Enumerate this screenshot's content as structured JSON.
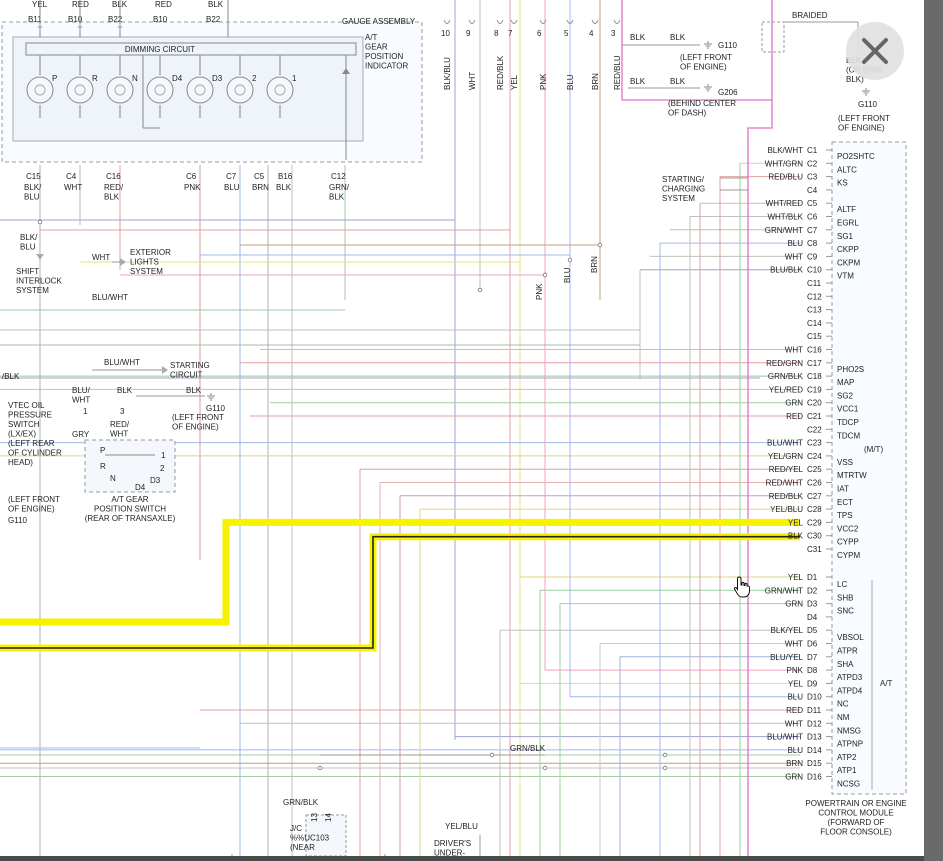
{
  "gauge": {
    "title": "GAUGE ASSEMBLY",
    "dimming": "DIMMING CIRCUIT",
    "indicator": [
      "A/T",
      "GEAR",
      "POSITION",
      "INDICATOR"
    ],
    "bulbs": [
      "P",
      "R",
      "N",
      "D4",
      "D3",
      "2",
      "1"
    ],
    "top_pins": [
      {
        "w": "YEL",
        "p": "B11"
      },
      {
        "w": "RED",
        "p": "B10"
      },
      {
        "w": "BLK",
        "p": "B22"
      }
    ],
    "bottom_pins": [
      {
        "p": "C15",
        "w": [
          "BLK/",
          "BLU"
        ]
      },
      {
        "p": "C4",
        "w": [
          "WHT"
        ]
      },
      {
        "p": "C16",
        "w": [
          "RED/",
          "BLK"
        ]
      },
      {
        "p": "C6",
        "w": [
          "PNK"
        ]
      },
      {
        "p": "C7",
        "w": [
          "BLU"
        ]
      },
      {
        "p": "C5",
        "w": [
          "BRN"
        ]
      },
      {
        "p": "B16",
        "w": [
          "BLK"
        ]
      },
      {
        "p": "C12",
        "w": [
          "GRN/",
          "BLK"
        ]
      }
    ]
  },
  "top_connector": {
    "pins": [
      "10",
      "9",
      "8",
      "7",
      "6",
      "5",
      "4",
      "3"
    ],
    "wires": [
      "BLK/BLU",
      "WHT",
      "RED/BLK",
      "YEL",
      "PNK",
      "BLU",
      "BRN",
      "RED/BLU"
    ]
  },
  "grounds": {
    "g110_top": {
      "wire1": "BLK",
      "wire2": "BLK",
      "id": "G110",
      "loc": [
        "(LEFT FRONT",
        "OF ENGINE)"
      ]
    },
    "g206": {
      "wire1": "BLK",
      "wire2": "BLK",
      "id": "G206",
      "loc": [
        "(BEHIND CENTER",
        "OF DASH)"
      ]
    },
    "braided": {
      "label": "BRAIDED",
      "wire": [
        "BLK",
        "(OR BRN/",
        "BLK)"
      ],
      "id": "G110",
      "loc": [
        "(LEFT FRONT",
        "OF ENGINE)"
      ]
    },
    "g110_mid": {
      "wire": "BLK",
      "id": "G110",
      "loc": [
        "(LEFT FRONT",
        "OF ENGINE)"
      ]
    },
    "g110_left": {
      "loc": [
        "(LEFT FRONT",
        "OF ENGINE)"
      ],
      "id": "G110"
    }
  },
  "left_labels": {
    "blk_blu": [
      "BLK/",
      "BLU"
    ],
    "shift": [
      "SHIFT",
      "INTERLOCK",
      "SYSTEM"
    ],
    "wht": "WHT",
    "exterior": [
      "EXTERIOR",
      "LIGHTS",
      "SYSTEM"
    ],
    "blu_wht": "BLU/WHT",
    "blu_wht2": "BLU/WHT",
    "starting": [
      "STARTING",
      "CIRCUIT"
    ],
    "blk_frag": "/BLK",
    "vtec": [
      "VTEC OIL",
      "PRESSURE",
      "SWITCH",
      "(LX/EX)",
      "(LEFT REAR",
      "OF CYLINDER",
      "HEAD)"
    ],
    "sw_wires": [
      "BLU/",
      "WHT"
    ],
    "sw_pin1": "1",
    "gry": "GRY",
    "blk3": "BLK",
    "pin3": "3",
    "red_wht": [
      "RED/",
      "WHT"
    ],
    "atgear_switch": [
      "A/T GEAR",
      "POSITION SWITCH",
      "(REAR OF TRANSAXLE)"
    ],
    "sw_letters": [
      "P",
      "R",
      "N",
      "D4",
      "D3",
      "1",
      "2"
    ]
  },
  "starting_charging": [
    "STARTING/",
    "CHARGING",
    "SYSTEM"
  ],
  "module": {
    "title": [
      "POWERTRAIN OR ENGINE",
      "CONTROL MODULE",
      "(FORWARD OF",
      "FLOOR CONSOLE)"
    ],
    "mt": "(M/T)",
    "at": "A/T",
    "pins": [
      {
        "w": "BLK/WHT",
        "p": "C1",
        "s": "PO2SHTC"
      },
      {
        "w": "WHT/GRN",
        "p": "C2",
        "s": "ALTC"
      },
      {
        "w": "RED/BLU",
        "p": "C3",
        "s": "KS"
      },
      {
        "w": "",
        "p": "C4",
        "s": ""
      },
      {
        "w": "WHT/RED",
        "p": "C5",
        "s": "ALTF"
      },
      {
        "w": "WHT/BLK",
        "p": "C6",
        "s": "EGRL"
      },
      {
        "w": "GRN/WHT",
        "p": "C7",
        "s": "SG1"
      },
      {
        "w": "BLU",
        "p": "C8",
        "s": "CKPP"
      },
      {
        "w": "WHT",
        "p": "C9",
        "s": "CKPM"
      },
      {
        "w": "BLU/BLK",
        "p": "C10",
        "s": "VTM"
      },
      {
        "w": "",
        "p": "C11",
        "s": ""
      },
      {
        "w": "",
        "p": "C12",
        "s": ""
      },
      {
        "w": "",
        "p": "C13",
        "s": ""
      },
      {
        "w": "",
        "p": "C14",
        "s": ""
      },
      {
        "w": "",
        "p": "C15",
        "s": ""
      },
      {
        "w": "WHT",
        "p": "C16",
        "s": ""
      },
      {
        "w": "RED/GRN",
        "p": "C17",
        "s": "PHO2S"
      },
      {
        "w": "GRN/BLK",
        "p": "C18",
        "s": "MAP"
      },
      {
        "w": "YEL/RED",
        "p": "C19",
        "s": "SG2"
      },
      {
        "w": "GRN",
        "p": "C20",
        "s": "VCC1"
      },
      {
        "w": "RED",
        "p": "C21",
        "s": "TDCP"
      },
      {
        "w": "",
        "p": "C22",
        "s": "TDCM"
      },
      {
        "w": "BLU/WHT",
        "p": "C23",
        "s": ""
      },
      {
        "w": "YEL/GRN",
        "p": "C24",
        "s": "VSS"
      },
      {
        "w": "RED/YEL",
        "p": "C25",
        "s": "MTRTW"
      },
      {
        "w": "RED/WHT",
        "p": "C26",
        "s": "IAT"
      },
      {
        "w": "RED/BLK",
        "p": "C27",
        "s": "ECT"
      },
      {
        "w": "YEL/BLU",
        "p": "C28",
        "s": "TPS"
      },
      {
        "w": "YEL",
        "p": "C29",
        "s": "VCC2"
      },
      {
        "w": "BLK",
        "p": "C30",
        "s": "CYPP"
      },
      {
        "w": "",
        "p": "C31",
        "s": "CYPM"
      },
      {
        "w": "YEL",
        "p": "D1",
        "s": "LC"
      },
      {
        "w": "GRN/WHT",
        "p": "D2",
        "s": "SHB"
      },
      {
        "w": "GRN",
        "p": "D3",
        "s": "SNC"
      },
      {
        "w": "",
        "p": "D4",
        "s": ""
      },
      {
        "w": "BLK/YEL",
        "p": "D5",
        "s": "VBSOL"
      },
      {
        "w": "WHT",
        "p": "D6",
        "s": "ATPR"
      },
      {
        "w": "BLU/YEL",
        "p": "D7",
        "s": "SHA"
      },
      {
        "w": "PNK",
        "p": "D8",
        "s": "ATPD3"
      },
      {
        "w": "YEL",
        "p": "D9",
        "s": "ATPD4"
      },
      {
        "w": "BLU",
        "p": "D10",
        "s": "NC"
      },
      {
        "w": "RED",
        "p": "D11",
        "s": "NM"
      },
      {
        "w": "WHT",
        "p": "D12",
        "s": "NMSG"
      },
      {
        "w": "BLU/WHT",
        "p": "D13",
        "s": "ATPNP"
      },
      {
        "w": "BLU",
        "p": "D14",
        "s": "ATP2"
      },
      {
        "w": "BRN",
        "p": "D15",
        "s": "ATP1"
      },
      {
        "w": "GRN",
        "p": "D16",
        "s": "NCSG"
      }
    ]
  },
  "mid_labels": {
    "pnk": "PNK",
    "blu": "BLU",
    "brn": "BRN",
    "grn_blk": "GRN/BLK"
  },
  "bottom": {
    "grn_blk": "GRN/BLK",
    "jc": [
      "J/C",
      "%%UC103",
      "(NEAR"
    ],
    "yel_blu": "YEL/BLU",
    "driver": [
      "DRIVER'S",
      "UNDER-"
    ],
    "pins": [
      "13",
      "14"
    ]
  },
  "ui": {
    "close_icon": "close-x-icon",
    "cursor_icon": "hand-pointer-icon"
  },
  "colors": {
    "highlight": "#f7f200",
    "pink": "#e070c8",
    "sheet": "#ffffff"
  }
}
